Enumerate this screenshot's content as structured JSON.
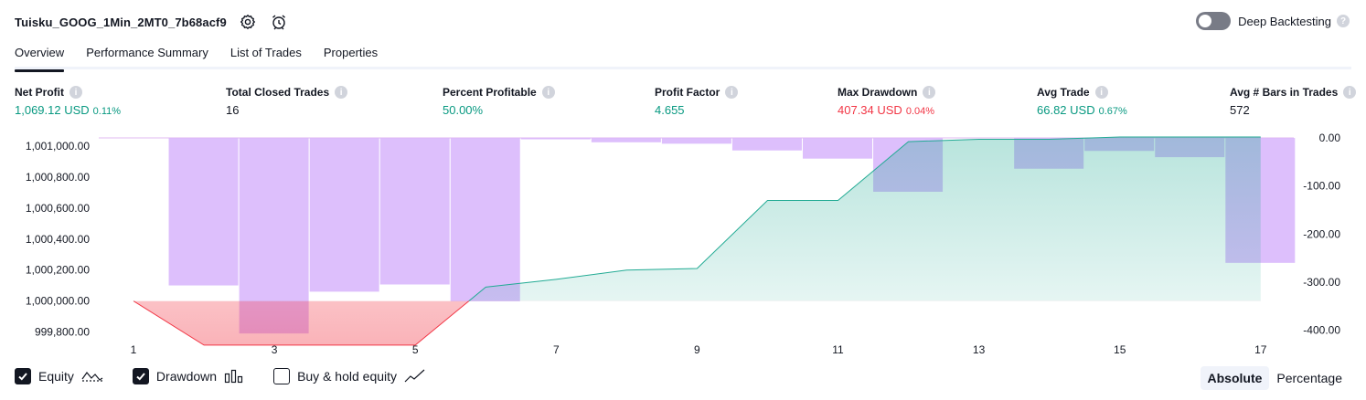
{
  "header": {
    "strategy_title": "Tuisku_GOOG_1Min_2MT0_7b68acf9",
    "settings_icon": "gear-icon",
    "alert_icon": "alarm-clock-icon",
    "deep_backtesting_label": "Deep Backtesting",
    "deep_backtesting_on": false
  },
  "tabs": [
    {
      "label": "Overview",
      "active": true
    },
    {
      "label": "Performance Summary",
      "active": false
    },
    {
      "label": "List of Trades",
      "active": false
    },
    {
      "label": "Properties",
      "active": false
    }
  ],
  "stats": {
    "net_profit": {
      "label": "Net Profit",
      "value": "1,069.12 USD",
      "pct": "0.11%"
    },
    "total_closed_trades": {
      "label": "Total Closed Trades",
      "value": "16"
    },
    "percent_profitable": {
      "label": "Percent Profitable",
      "value": "50.00%"
    },
    "profit_factor": {
      "label": "Profit Factor",
      "value": "4.655"
    },
    "max_drawdown": {
      "label": "Max Drawdown",
      "value": "407.34 USD",
      "pct": "0.04%"
    },
    "avg_trade": {
      "label": "Avg Trade",
      "value": "66.82 USD",
      "pct": "0.67%"
    },
    "avg_bars": {
      "label": "Avg # Bars in Trades",
      "value": "572"
    }
  },
  "colors": {
    "green": "#089981",
    "red": "#f23645",
    "drawdown_bar": "#d7b4fb",
    "equity_line": "#22ab94"
  },
  "chart_data": {
    "type": "area",
    "left_axis": {
      "ticks": [
        "1,001,000.00",
        "1,000,800.00",
        "1,000,600.00",
        "1,000,400.00",
        "1,000,200.00",
        "1,000,000.00",
        "999,800.00"
      ],
      "ylim": [
        999750,
        1001060
      ]
    },
    "right_axis": {
      "ticks": [
        "0.00",
        "-100.00",
        "-200.00",
        "-300.00",
        "-400.00"
      ],
      "ylim": [
        -420,
        2
      ]
    },
    "x_ticks": [
      "1",
      "3",
      "5",
      "7",
      "9",
      "11",
      "13",
      "15",
      "17"
    ],
    "series": [
      {
        "name": "Equity",
        "x": [
          1,
          2,
          3,
          4,
          5,
          6,
          7,
          8,
          9,
          10,
          11,
          12,
          13,
          14,
          15,
          16,
          17
        ],
        "values": [
          1000000,
          999715,
          999715,
          999715,
          999715,
          1000090,
          1000140,
          1000200,
          1000210,
          1000650,
          1000650,
          1001030,
          1001045,
          1001045,
          1001060,
          1001060,
          1001060
        ]
      },
      {
        "name": "Drawdown",
        "x": [
          2,
          3,
          4,
          5,
          6,
          7,
          8,
          9,
          10,
          11,
          12,
          13,
          14,
          15,
          16,
          17
        ],
        "values": [
          -307,
          -407,
          -320,
          -305,
          -340,
          -2,
          -9,
          -12,
          -26,
          -43,
          -112,
          0,
          -64,
          -27,
          -40,
          -260
        ]
      }
    ]
  },
  "legend": {
    "equity": {
      "label": "Equity",
      "checked": true
    },
    "drawdown": {
      "label": "Drawdown",
      "checked": true
    },
    "buy_hold": {
      "label": "Buy & hold equity",
      "checked": false
    }
  },
  "mode": {
    "absolute_label": "Absolute",
    "percentage_label": "Percentage",
    "selected": "Absolute"
  }
}
